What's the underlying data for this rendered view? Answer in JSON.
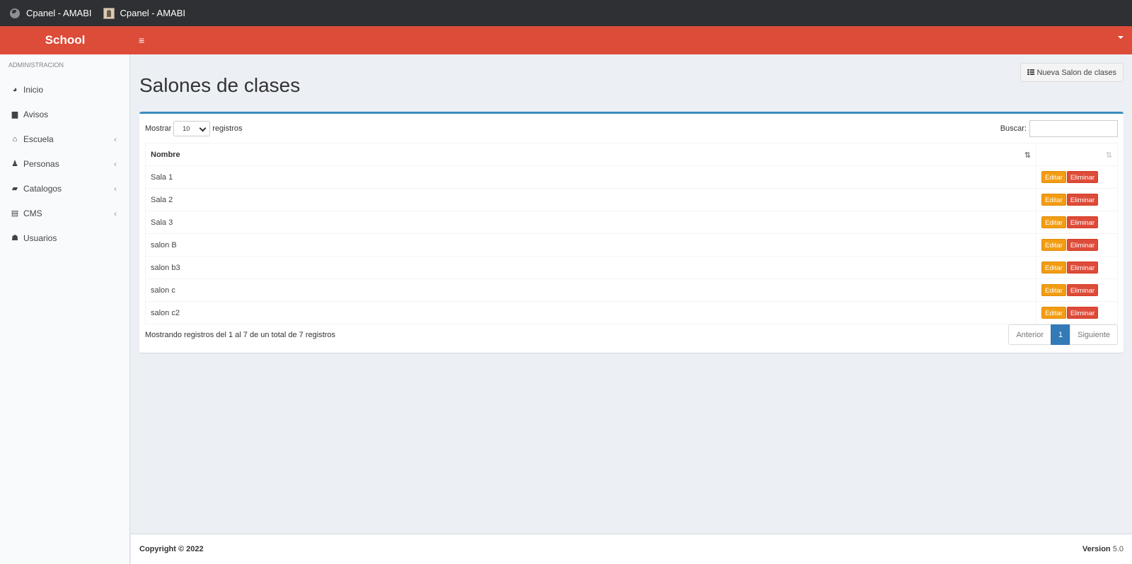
{
  "topbar": {
    "tab1_title": "Cpanel - AMABI",
    "tab2_title": "Cpanel - AMABI"
  },
  "header": {
    "logo": "School",
    "menu_icon": "≡"
  },
  "sidebar": {
    "section_label": "ADMINISTRACION",
    "items": [
      {
        "label": "Inicio",
        "icon": "dashboard-icon"
      },
      {
        "label": "Avisos",
        "icon": "file-icon"
      },
      {
        "label": "Escuela",
        "icon": "bank-icon"
      },
      {
        "label": "Personas",
        "icon": "person-icon"
      },
      {
        "label": "Catalogos",
        "icon": "book-icon"
      },
      {
        "label": "CMS",
        "icon": "document-icon"
      },
      {
        "label": "Usuarios",
        "icon": "users-icon"
      }
    ]
  },
  "main": {
    "title": "Salones de clases",
    "new_button": "Nueva Salon de clases",
    "length_prefix": "Mostrar",
    "length_value": "10",
    "length_suffix": "registros",
    "search_label": "Buscar:",
    "columns": [
      "Nombre",
      ""
    ],
    "rows": [
      "Sala 1",
      "Sala 2",
      "Sala 3",
      "salon B",
      "salon b3",
      "salon c",
      "salon c2"
    ],
    "edit_label": "Editar",
    "delete_label": "Eliminar",
    "info": "Mostrando registros del 1 al 7 de un total de 7 registros",
    "pagination": {
      "prev": "Anterior",
      "current": "1",
      "next": "Siguiente"
    }
  },
  "footer": {
    "copyright": "Copyright © 2022",
    "version_label": "Version",
    "version_number": "5.0"
  },
  "colors": {
    "header": "#dd4b39",
    "accent": "#3c8dbc",
    "edit": "#f39c12",
    "delete": "#dd4b39"
  }
}
